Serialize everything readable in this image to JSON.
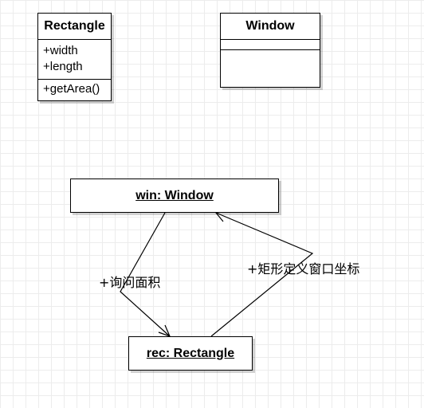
{
  "classes": {
    "rectangle": {
      "name": "Rectangle",
      "attributes": [
        "+width",
        "+length"
      ],
      "operations": [
        "+getArea()"
      ]
    },
    "window": {
      "name": "Window",
      "attributes": [],
      "operations": []
    }
  },
  "objects": {
    "win": "win: Window",
    "rec": "rec: Rectangle"
  },
  "messages": {
    "win_to_rec": "+询问面积",
    "rec_to_win": "+矩形定义窗口坐标"
  },
  "colors": {
    "line": "#000000",
    "grid": "#ececec",
    "box_fill": "#ffffff"
  }
}
